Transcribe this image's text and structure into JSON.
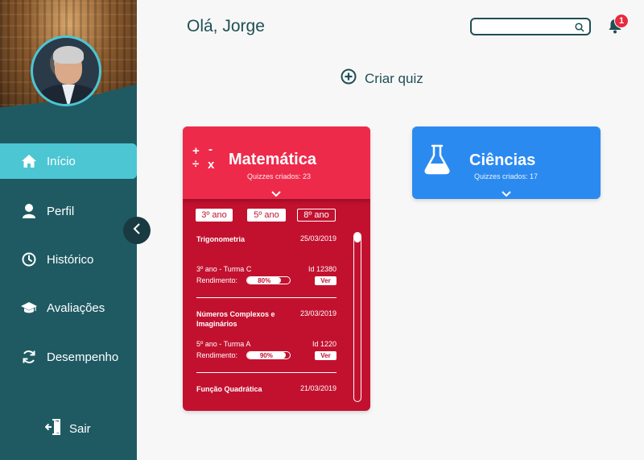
{
  "header": {
    "greeting": "Olá, Jorge",
    "search_placeholder": "",
    "notification_count": "1"
  },
  "sidebar": {
    "items": [
      {
        "label": "Início",
        "icon": "home-icon",
        "active": true
      },
      {
        "label": "Perfil",
        "icon": "user-icon",
        "active": false
      },
      {
        "label": "Histórico",
        "icon": "clock-icon",
        "active": false
      },
      {
        "label": "Avaliações",
        "icon": "graduation-cap-icon",
        "active": false
      },
      {
        "label": "Desempenho",
        "icon": "refresh-icon",
        "active": false
      }
    ],
    "logout_label": "Sair"
  },
  "main": {
    "create_quiz_label": "Criar quiz",
    "cards": [
      {
        "title": "Matemática",
        "subtitle": "Quizzes criados: 23",
        "color": "#ee2a4b",
        "icon": "math-operators-icon",
        "tabs": [
          "3º ano",
          "5º ano",
          "8º ano"
        ],
        "selected_tab": "8º ano",
        "quizzes": [
          {
            "name": "Trigonometria",
            "date": "25/03/2019",
            "class": "3º ano - Turma C",
            "id": "Id 12380",
            "performance_label": "Rendimento:",
            "performance": "80%",
            "performance_value": 0.8,
            "action": "Ver"
          },
          {
            "name": "Números Complexos e Imaginários",
            "date": "23/03/2019",
            "class": "5º ano - Turma A",
            "id": "Id 1220",
            "performance_label": "Rendimento:",
            "performance": "90%",
            "performance_value": 0.9,
            "action": "Ver"
          },
          {
            "name": "Função Quadrática",
            "date": "21/03/2019"
          }
        ]
      },
      {
        "title": "Ciências",
        "subtitle": "Quizzes criados: 17",
        "color": "#2b8af0",
        "icon": "flask-icon"
      }
    ]
  },
  "colors": {
    "sidebar": "#1f5a63",
    "active_nav": "#4cc6d3",
    "math_card": "#c2112f",
    "science_card": "#2b8af0",
    "badge": "#e8293f"
  }
}
